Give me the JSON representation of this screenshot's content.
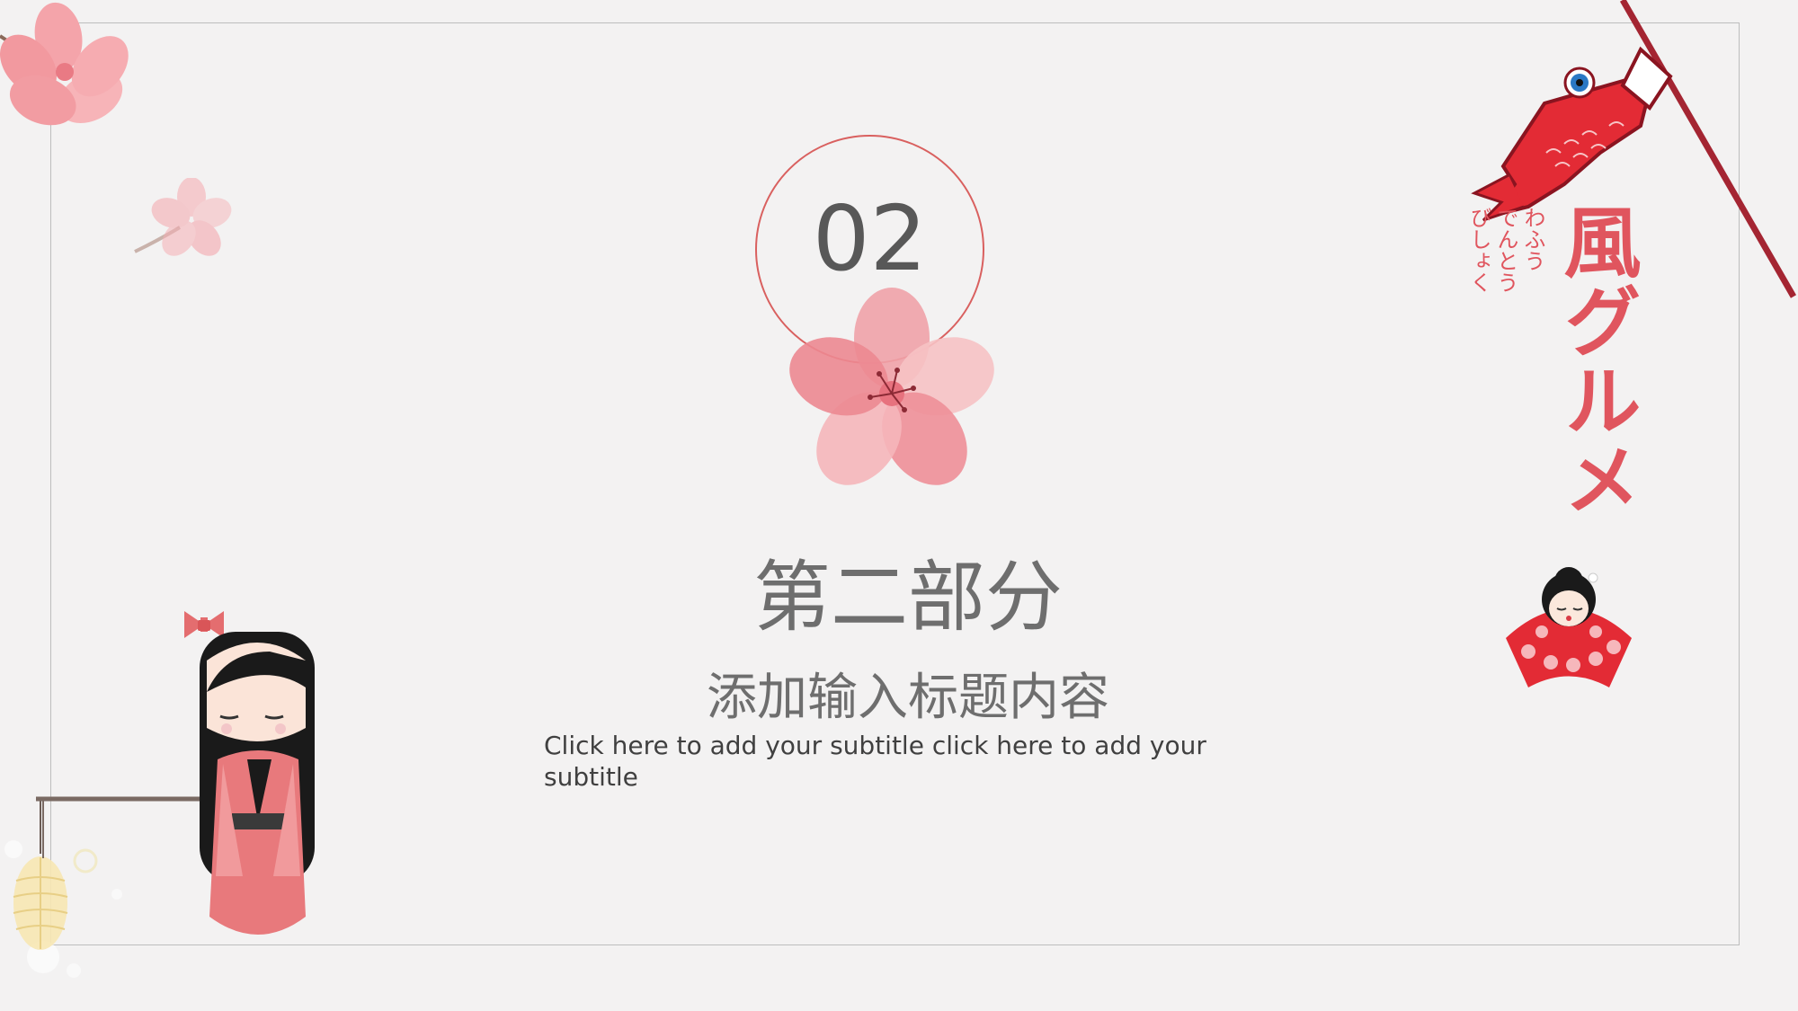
{
  "slide": {
    "section_number": "02",
    "section_title": "第二部分",
    "section_heading": "添加输入标题内容",
    "subtitle": "Click here to add your subtitle click here to add your subtitle"
  },
  "decoration": {
    "vertical_title": "風グルメ",
    "kana_lines": [
      "わふう",
      "でんとう",
      "びしょく"
    ]
  },
  "colors": {
    "background": "#f3f2f2",
    "frame": "#bdbdbd",
    "accent": "#d9605f",
    "title_text": "#6e6e6e",
    "brand_red": "#e0555e"
  },
  "icons": [
    "cherry-blossom-icon",
    "koinobori-carp-icon",
    "kokeshi-doll-icon",
    "geisha-fan-icon",
    "paper-lantern-icon"
  ]
}
